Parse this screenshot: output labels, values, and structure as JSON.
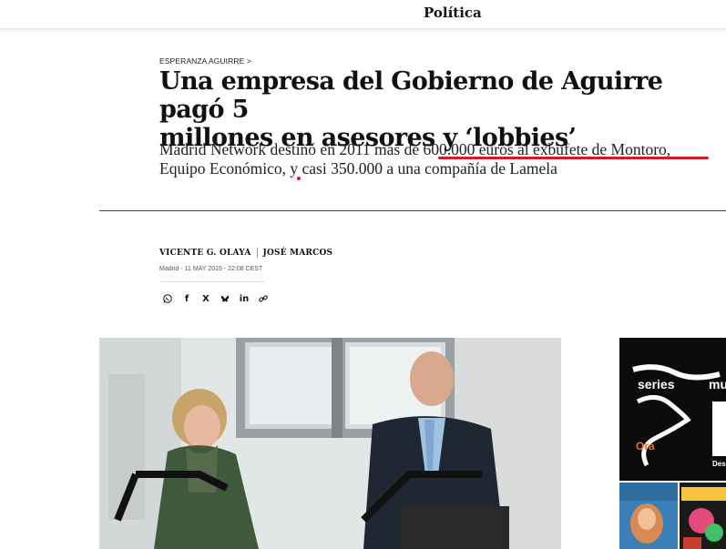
{
  "header": {
    "section": "Política"
  },
  "article": {
    "kicker": "ESPERANZA AGUIRRE >",
    "headline_line1": "Una empresa del Gobierno de Aguirre pagó 5",
    "headline_line2": "millones en asesores y ‘lobbies’",
    "standfirst_line1": "Madrid Network destinó en 2011 más de 600.000 euros al exbufete de Montoro,",
    "standfirst_line2": "Equipo Económico, y casi 350.000 a una compañía de Lamela",
    "author1": "VICENTE G. OLAYA",
    "author2": "JOSÉ MARCOS",
    "dateline": "Madrid - 11 MAY 2015 - 22:08 CEST"
  },
  "share": {
    "icons": [
      "whatsapp-icon",
      "facebook-icon",
      "x-icon",
      "bluesky-icon",
      "linkedin-icon",
      "link-icon"
    ],
    "facebook": "f",
    "x": "X",
    "linkedin": "in"
  },
  "ad": {
    "line1": "series",
    "line2": "mu",
    "line3": "Ora",
    "line4": "Desc"
  },
  "colors": {
    "accent_red": "#d11a2a",
    "ad_orange": "#f26a21"
  }
}
